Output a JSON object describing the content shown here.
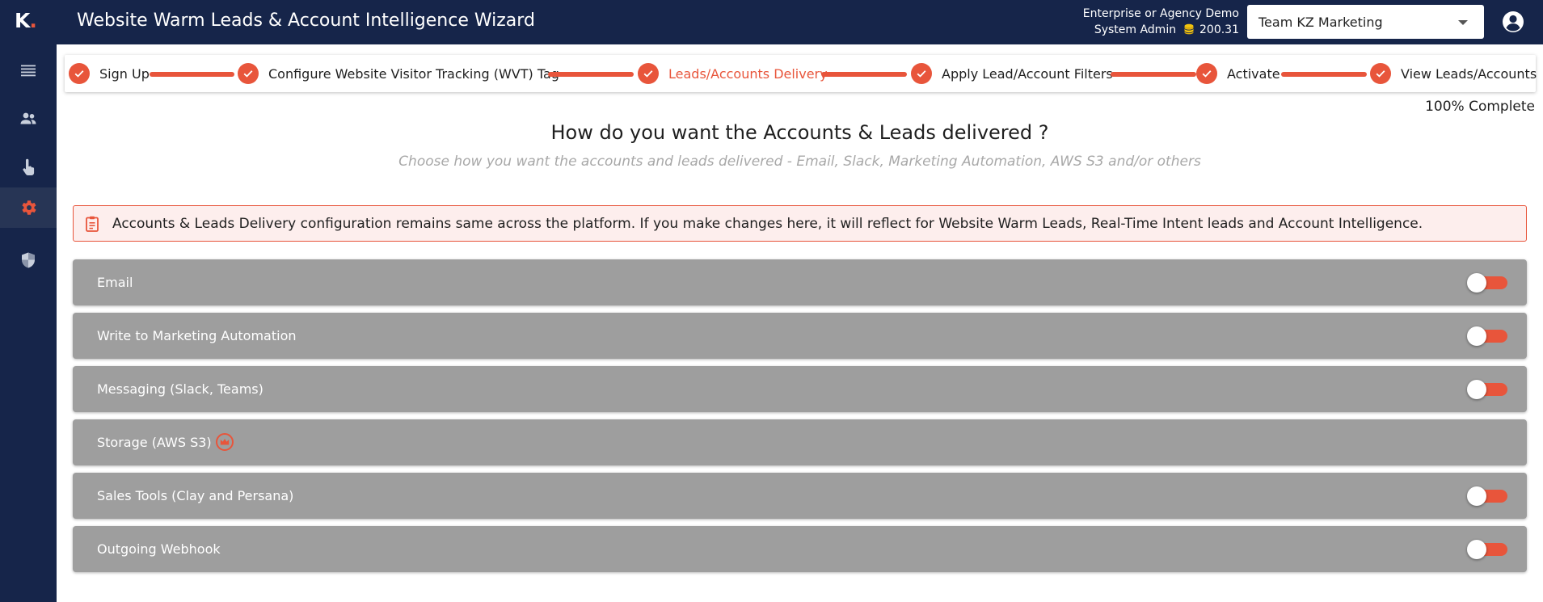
{
  "header": {
    "logo_letter": "K",
    "logo_dot": ".",
    "title": "Website Warm Leads & Account Intelligence Wizard",
    "plan": "Enterprise or Agency Demo",
    "role": "System Admin",
    "credits": "200.31",
    "team_selected": "Team KZ Marketing",
    "user_icon": "account-circle-icon"
  },
  "sidebar": {
    "items": [
      {
        "icon": "menu-icon"
      },
      {
        "icon": "users-icon"
      },
      {
        "icon": "touch-icon"
      },
      {
        "icon": "gear-icon",
        "active": true
      },
      {
        "icon": "shield-icon"
      }
    ]
  },
  "stepper": {
    "steps": [
      {
        "label": "Sign Up",
        "done": true
      },
      {
        "label": "Configure Website Visitor Tracking (WVT) Tag",
        "done": true
      },
      {
        "label": "Leads/Accounts Delivery",
        "done": true,
        "current": true
      },
      {
        "label": "Apply Lead/Account Filters",
        "done": true
      },
      {
        "label": "Activate",
        "done": true
      },
      {
        "label": "View Leads/Accounts",
        "done": true
      }
    ],
    "progress_text": "100% Complete"
  },
  "main": {
    "heading": "How do you want the Accounts & Leads delivered ?",
    "subheading": "Choose how you want the accounts and leads delivered - Email, Slack, Marketing Automation, AWS S3 and/or others",
    "notice": "Accounts & Leads Delivery configuration remains same across the platform. If you make changes here, it will reflect for Website Warm Leads, Real-Time Intent leads and Account Intelligence.",
    "options": [
      {
        "label": "Email",
        "toggle": true,
        "enabled": false
      },
      {
        "label": "Write to Marketing Automation",
        "toggle": true,
        "enabled": false
      },
      {
        "label": "Messaging (Slack, Teams)",
        "toggle": true,
        "enabled": false
      },
      {
        "label": "Storage (AWS S3)",
        "toggle": false,
        "premium_icon": "crown-icon"
      },
      {
        "label": "Sales Tools (Clay and Persana)",
        "toggle": true,
        "enabled": false
      },
      {
        "label": "Outgoing Webhook",
        "toggle": true,
        "enabled": false
      }
    ]
  },
  "colors": {
    "navy": "#16254a",
    "accent": "#e8553b",
    "row_gray": "#9e9e9e",
    "notice_bg": "#fdeeed",
    "credit_coin": "#f2c40f"
  }
}
